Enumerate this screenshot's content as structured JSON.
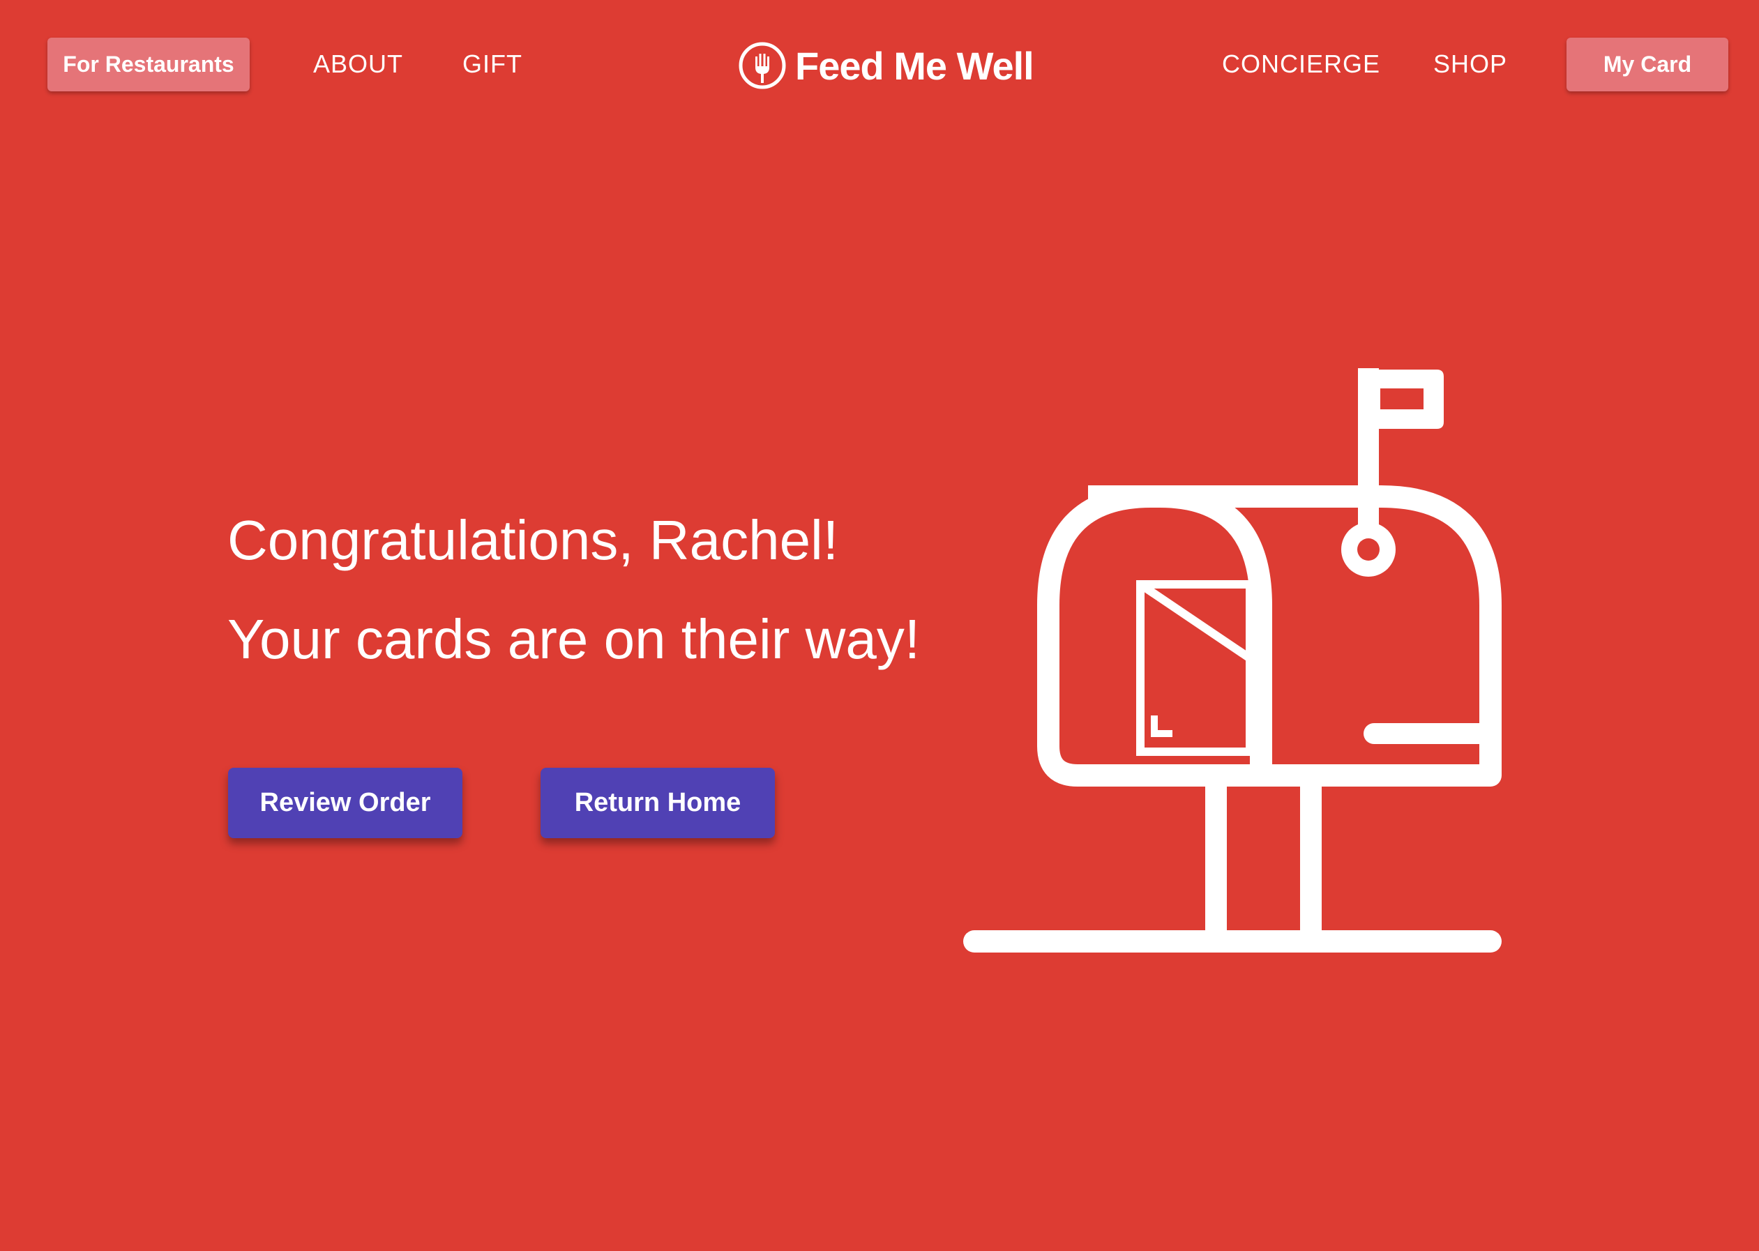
{
  "header": {
    "left_button_label": "For Restaurants",
    "nav_left": [
      "ABOUT",
      "GIFT"
    ],
    "logo_text": "Feed Me Well",
    "nav_right": [
      "CONCIERGE",
      "SHOP"
    ],
    "right_button_label": "My Card"
  },
  "main": {
    "headline": "Congratulations, Rachel!",
    "subheadline": "Your cards are on their way!",
    "primary_button_label": "Review Order",
    "secondary_button_label": "Return Home"
  },
  "illustration": {
    "icon": "mailbox-icon"
  },
  "colors": {
    "background": "#dd3c33",
    "pill_button": "#e57478",
    "cta_button": "#5041b4",
    "foreground": "#ffffff"
  }
}
